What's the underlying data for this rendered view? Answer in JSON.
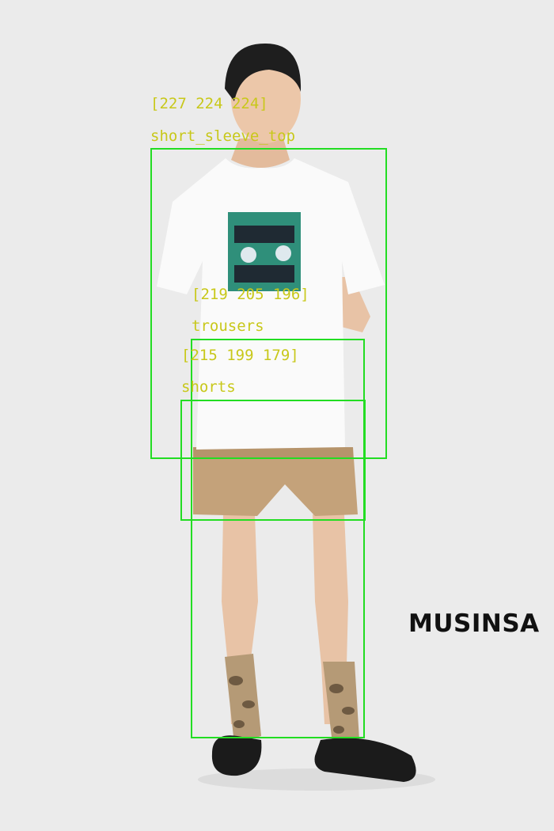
{
  "brand": "MUSINSA",
  "detections": [
    {
      "label": "short_sleeve_top",
      "color_text": "[227 224 224]"
    },
    {
      "label": "trousers",
      "color_text": "[219 205 196]"
    },
    {
      "label": "shorts",
      "color_text": "[215 199 179]"
    }
  ],
  "colors": {
    "background": "#ebebeb",
    "box_stroke": "#22dd22",
    "label_text": "#c8c81a",
    "brand_text": "#111111"
  }
}
